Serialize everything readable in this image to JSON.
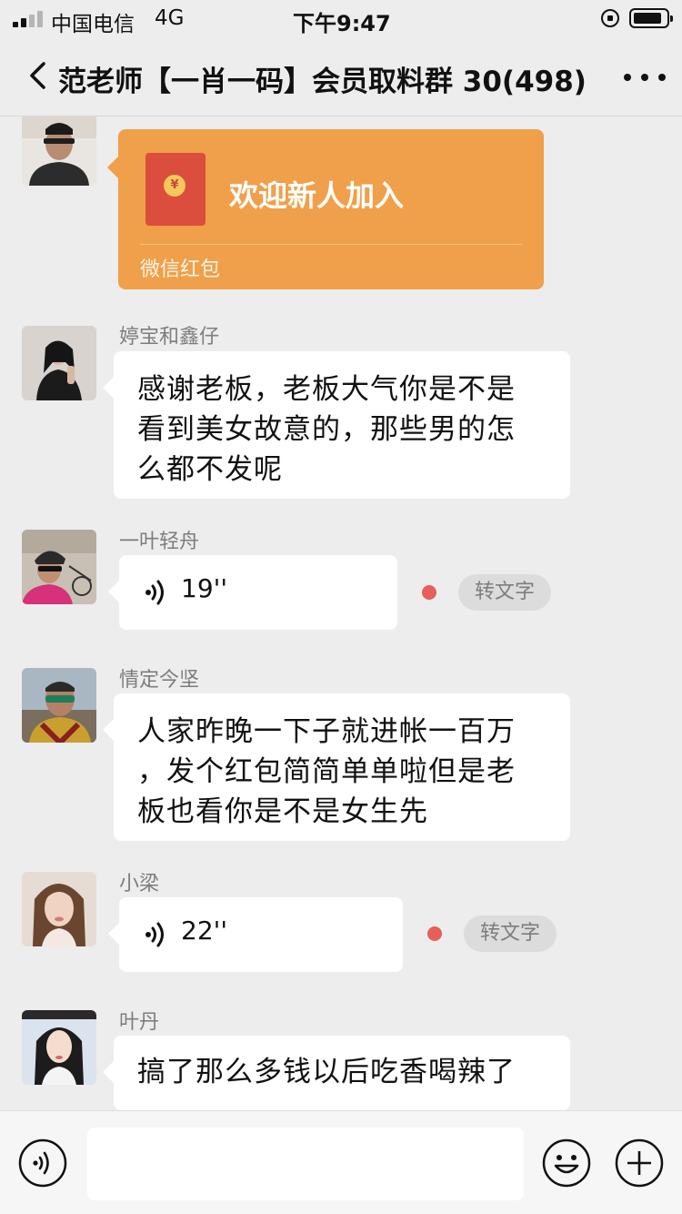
{
  "status_bar": {
    "carrier": "中国电信",
    "network": "4G",
    "time": "下午9:47"
  },
  "nav": {
    "title": "范老师【一肖一码】会员取料群 30(498)"
  },
  "messages": [
    {
      "type": "red_packet",
      "sender": "",
      "text": "欢迎新人加入",
      "footer": "微信红包",
      "seal": "¥"
    },
    {
      "type": "text",
      "sender": "婷宝和鑫仔",
      "lines": [
        "感谢老板，老板大气你是不是",
        "看到美女故意的，那些男的怎",
        "么都不发呢"
      ]
    },
    {
      "type": "voice",
      "sender": "一叶轻舟",
      "duration": "19''",
      "to_text": "转文字"
    },
    {
      "type": "text",
      "sender": "情定今坚",
      "lines": [
        "人家昨晚一下子就进帐一百万",
        "，发个红包简简单单啦但是老",
        "板也看你是不是女生先"
      ]
    },
    {
      "type": "voice",
      "sender": "小梁",
      "duration": "22''",
      "to_text": "转文字"
    },
    {
      "type": "text",
      "sender": "叶丹",
      "lines": [
        "搞了那么多钱以后吃香喝辣了"
      ]
    }
  ],
  "colors": {
    "background": "#ededed",
    "red_packet": "#f0a04a",
    "unread_dot": "#e75e5b"
  },
  "icons": {
    "back": "chevron-left-icon",
    "more": "more-dots-icon",
    "voice_input": "voice-input-icon",
    "emoji": "emoji-icon",
    "plus": "plus-icon"
  }
}
